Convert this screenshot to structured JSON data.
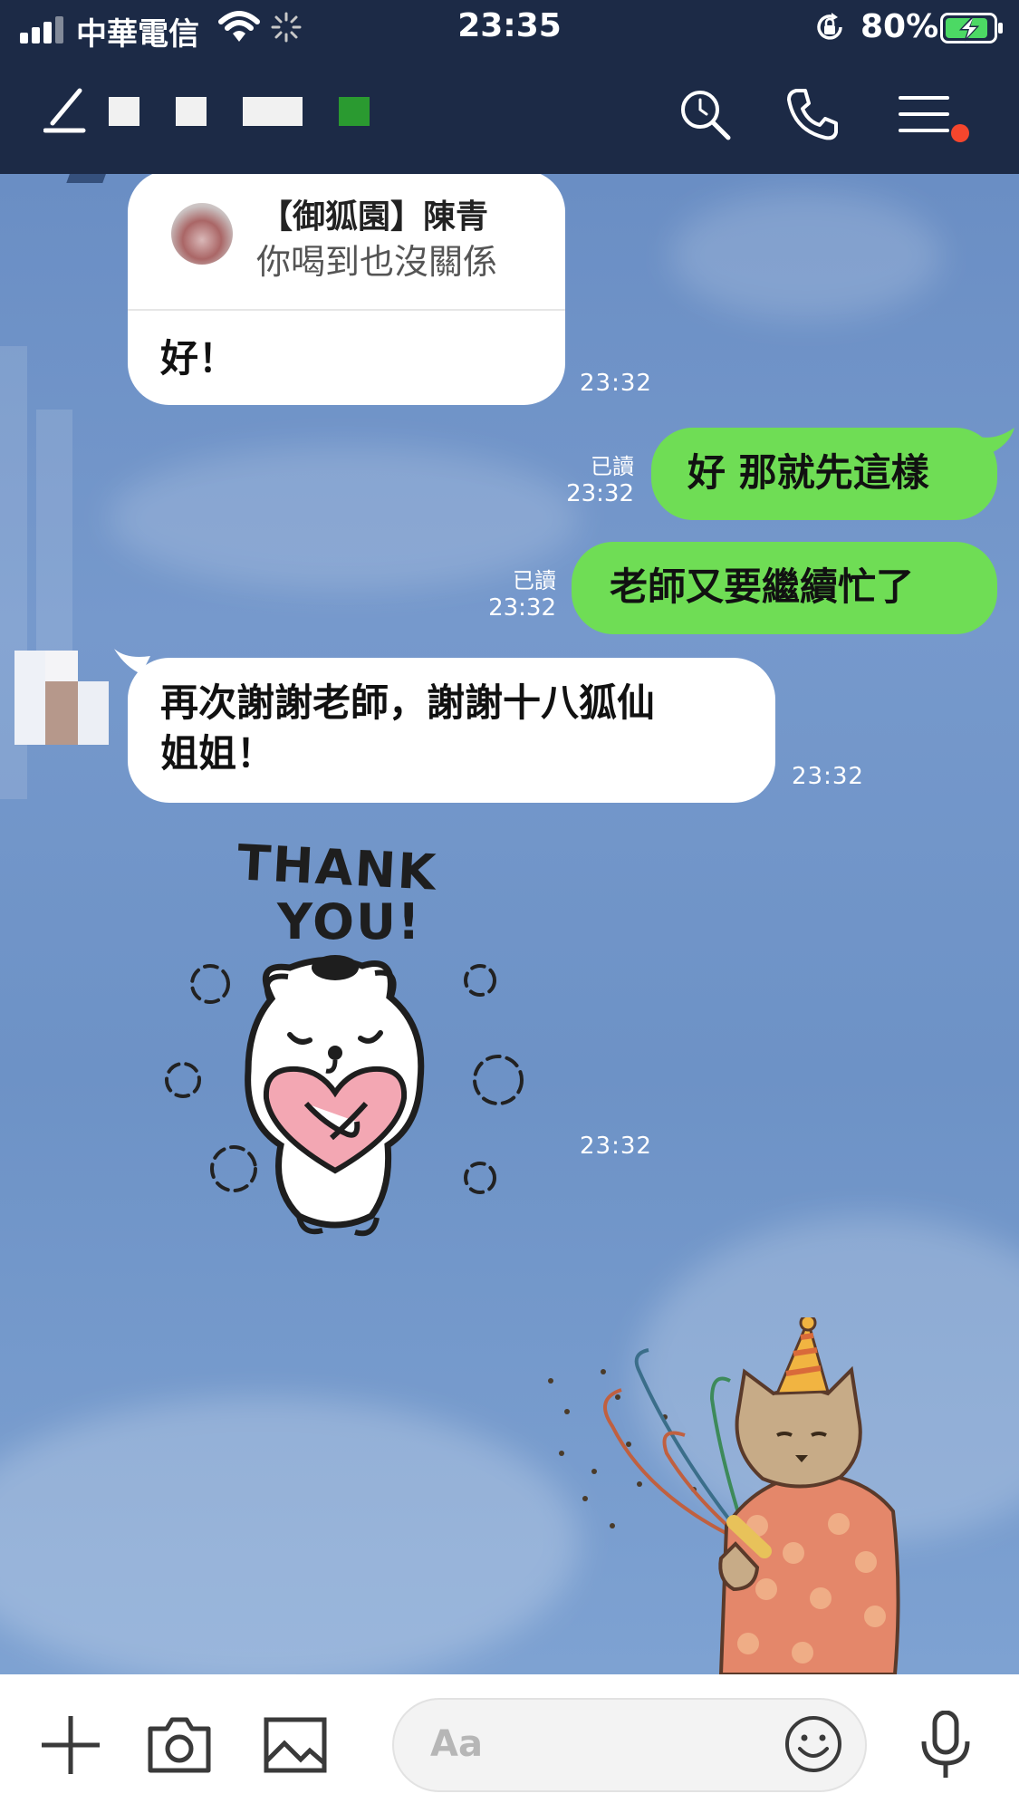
{
  "status_bar": {
    "carrier": "中華電信",
    "time": "23:35",
    "battery_percent": "80%",
    "signal_bars": 4,
    "battery_level": 0.8,
    "battery_charging": true
  },
  "header": {
    "has_unread_badge": true,
    "badge_color": "#f5462d",
    "icons": [
      "back-icon",
      "search-icon",
      "phone-icon",
      "menu-icon"
    ]
  },
  "messages": [
    {
      "side": "in",
      "reply_to": {
        "name": "【御狐園】陳青",
        "quote": "你喝到也沒關係"
      },
      "text": "好！",
      "time": "23:32"
    },
    {
      "side": "out",
      "text": "好 那就先這樣",
      "read_label": "已讀",
      "time": "23:32"
    },
    {
      "side": "out",
      "text": "老師又要繼續忙了",
      "read_label": "已讀",
      "time": "23:32"
    },
    {
      "side": "in",
      "text_line1": "再次謝謝老師，謝謝十八狐仙",
      "text_line2": "姐姐！",
      "time": "23:32"
    },
    {
      "side": "in",
      "type": "sticker",
      "sticker_text_line1": "THANK",
      "sticker_text_line2": "YOU!",
      "time": "23:32"
    }
  ],
  "input": {
    "placeholder": "Aa"
  },
  "colors": {
    "header_bg": "#1c2a46",
    "chat_bg": "#6d90c2",
    "outgoing_bubble": "#6fdd55",
    "incoming_bubble": "#ffffff"
  }
}
